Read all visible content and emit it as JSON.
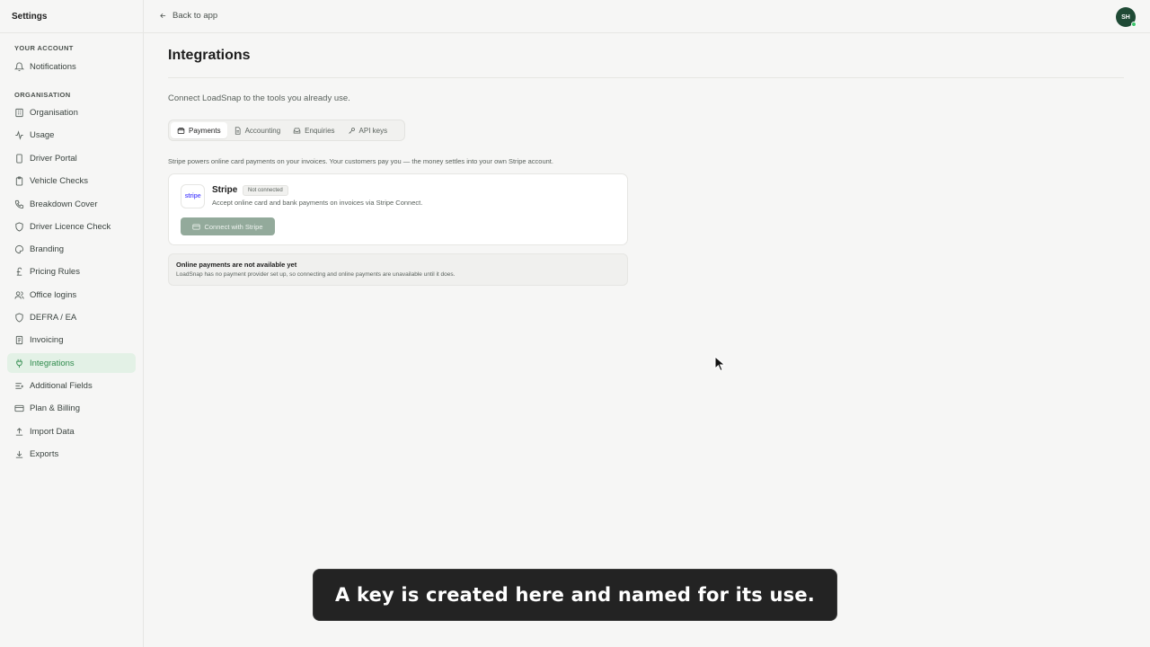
{
  "sidebar": {
    "title": "Settings",
    "sections": [
      {
        "label": "YOUR ACCOUNT"
      },
      {
        "label": "ORGANISATION"
      }
    ],
    "items": [
      {
        "label": "Notifications",
        "icon": "bell-icon"
      },
      {
        "label": "Organisation",
        "icon": "building-icon"
      },
      {
        "label": "Usage",
        "icon": "activity-icon"
      },
      {
        "label": "Driver Portal",
        "icon": "phone-icon"
      },
      {
        "label": "Vehicle Checks",
        "icon": "clipboard-icon"
      },
      {
        "label": "Breakdown Cover",
        "icon": "phone-call-icon"
      },
      {
        "label": "Driver Licence Check",
        "icon": "shield-icon"
      },
      {
        "label": "Branding",
        "icon": "palette-icon"
      },
      {
        "label": "Pricing Rules",
        "icon": "pound-icon"
      },
      {
        "label": "Office logins",
        "icon": "users-icon"
      },
      {
        "label": "DEFRA / EA",
        "icon": "shield-icon"
      },
      {
        "label": "Invoicing",
        "icon": "receipt-icon"
      },
      {
        "label": "Integrations",
        "icon": "plug-icon",
        "active": true
      },
      {
        "label": "Additional Fields",
        "icon": "list-icon"
      },
      {
        "label": "Plan & Billing",
        "icon": "credit-card-icon"
      },
      {
        "label": "Import Data",
        "icon": "upload-icon"
      },
      {
        "label": "Exports",
        "icon": "download-icon"
      }
    ]
  },
  "topbar": {
    "back_label": "Back to app",
    "avatar_initials": "SH"
  },
  "main": {
    "title": "Integrations",
    "subtitle": "Connect LoadSnap to the tools you already use.",
    "tabs": [
      {
        "label": "Payments",
        "icon": "wallet-icon",
        "active": true
      },
      {
        "label": "Accounting",
        "icon": "document-icon"
      },
      {
        "label": "Enquiries",
        "icon": "inbox-icon"
      },
      {
        "label": "API keys",
        "icon": "key-icon"
      }
    ],
    "description": "Stripe powers online card payments on your invoices. Your customers pay you — the money settles into your own Stripe account.",
    "provider": {
      "logo_text": "stripe",
      "name": "Stripe",
      "status": "Not connected",
      "description": "Accept online card and bank payments on invoices via Stripe Connect.",
      "button_label": "Connect with Stripe"
    },
    "notice": {
      "title": "Online payments are not available yet",
      "body": "LoadSnap has no payment provider set up, so connecting and online payments are unavailable until it does."
    }
  },
  "caption": "A key is created here and named for its use.",
  "colors": {
    "accent": "#2f8b4c",
    "active_bg": "#e3f1e6",
    "avatar": "#1f4a35",
    "stripe": "#635bff",
    "button_disabled": "#93aa9b"
  }
}
